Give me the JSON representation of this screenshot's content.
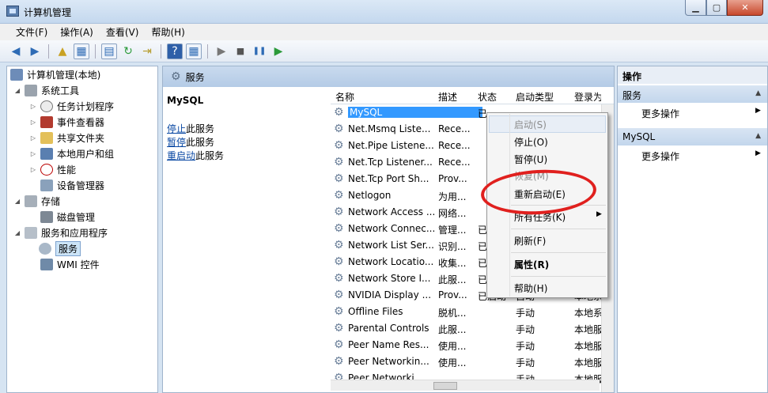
{
  "window": {
    "title": "计算机管理",
    "min": "▁",
    "max": "▢",
    "close": "✕"
  },
  "menu": [
    {
      "label": "文件(F)"
    },
    {
      "label": "操作(A)"
    },
    {
      "label": "查看(V)"
    },
    {
      "label": "帮助(H)"
    }
  ],
  "toolbar": {
    "back": "◀",
    "fwd": "▶",
    "play": "▶",
    "stop": "■",
    "pause": "❚❚",
    "resume": "▶"
  },
  "tree": {
    "root": "计算机管理(本地)",
    "system_tools": "系统工具",
    "task_scheduler": "任务计划程序",
    "event_viewer": "事件查看器",
    "shared_folders": "共享文件夹",
    "local_users": "本地用户和组",
    "performance": "性能",
    "device_manager": "设备管理器",
    "storage": "存储",
    "disk_management": "磁盘管理",
    "services_apps": "服务和应用程序",
    "services": "服务",
    "wmi": "WMI 控件"
  },
  "center": {
    "header": "服务",
    "selected_service": "MySQL",
    "actions": [
      {
        "link": "停止",
        "rest": "此服务"
      },
      {
        "link": "暂停",
        "rest": "此服务"
      },
      {
        "link": "重启动",
        "rest": "此服务"
      }
    ],
    "columns": {
      "name": "名称",
      "desc": "描述",
      "status": "状态",
      "startup": "启动类型",
      "logon": "登录为"
    },
    "rows": [
      {
        "name": "MySQL",
        "desc": "",
        "status": "已",
        "startup": "",
        "logon": ""
      },
      {
        "name": "Net.Msmq Liste...",
        "desc": "Rece...",
        "status": "",
        "startup": "",
        "logon": ""
      },
      {
        "name": "Net.Pipe Listene...",
        "desc": "Rece...",
        "status": "",
        "startup": "",
        "logon": ""
      },
      {
        "name": "Net.Tcp Listener...",
        "desc": "Rece...",
        "status": "",
        "startup": "",
        "logon": ""
      },
      {
        "name": "Net.Tcp Port Sh...",
        "desc": "Prov...",
        "status": "",
        "startup": "",
        "logon": ""
      },
      {
        "name": "Netlogon",
        "desc": "为用...",
        "status": "",
        "startup": "",
        "logon": ""
      },
      {
        "name": "Network Access ...",
        "desc": "网络...",
        "status": "",
        "startup": "",
        "logon": ""
      },
      {
        "name": "Network Connec...",
        "desc": "管理...",
        "status": "已",
        "startup": "",
        "logon": ""
      },
      {
        "name": "Network List Ser...",
        "desc": "识别...",
        "status": "已",
        "startup": "",
        "logon": ""
      },
      {
        "name": "Network Locatio...",
        "desc": "收集...",
        "status": "已",
        "startup": "",
        "logon": ""
      },
      {
        "name": "Network Store I...",
        "desc": "此服...",
        "status": "已",
        "startup": "",
        "logon": ""
      },
      {
        "name": "NVIDIA Display ...",
        "desc": "Prov...",
        "status": "已启动",
        "startup": "自动",
        "logon": "本地系"
      },
      {
        "name": "Offline Files",
        "desc": "脱机...",
        "status": "",
        "startup": "手动",
        "logon": "本地系"
      },
      {
        "name": "Parental Controls",
        "desc": "此服...",
        "status": "",
        "startup": "手动",
        "logon": "本地服"
      },
      {
        "name": "Peer Name Res...",
        "desc": "使用...",
        "status": "",
        "startup": "手动",
        "logon": "本地服"
      },
      {
        "name": "Peer Networkin...",
        "desc": "使用...",
        "status": "",
        "startup": "手动",
        "logon": "本地服"
      },
      {
        "name": "Peer Networki...",
        "desc": "",
        "status": "",
        "startup": "手动",
        "logon": "本地服"
      }
    ]
  },
  "context_menu": {
    "start": "启动(S)",
    "stop": "停止(O)",
    "pause": "暂停(U)",
    "resume": "恢复(M)",
    "restart": "重新启动(E)",
    "all_tasks": "所有任务(K)",
    "refresh": "刷新(F)",
    "properties": "属性(R)",
    "help": "帮助(H)"
  },
  "actions_pane": {
    "title": "操作",
    "section1": "服务",
    "more1": "更多操作",
    "section2": "MySQL",
    "more2": "更多操作"
  },
  "colors": {
    "selection": "#3399ff",
    "annotation": "#e0201e",
    "header": "#c9daee"
  }
}
